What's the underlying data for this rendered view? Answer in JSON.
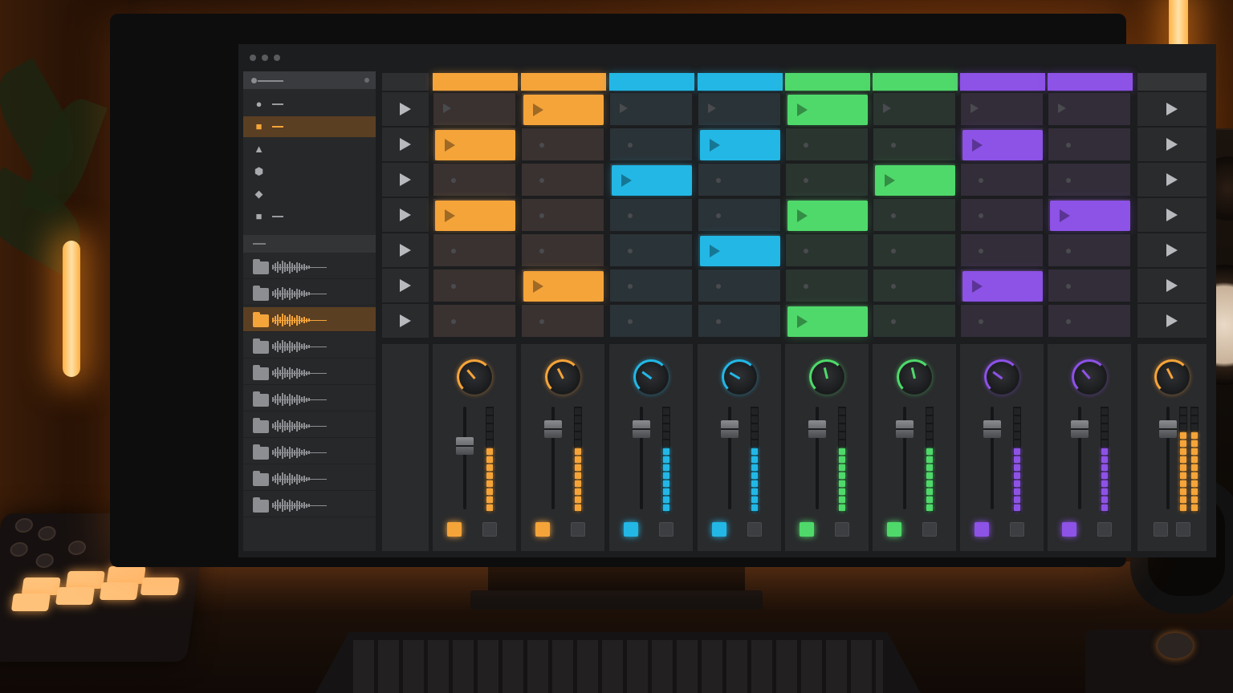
{
  "app": {
    "window_buttons": [
      "close",
      "minimize",
      "maximize"
    ]
  },
  "browser": {
    "header_icon": "search-icon",
    "categories": [
      {
        "icon": "circle-icon",
        "active": false
      },
      {
        "icon": "folder-icon",
        "active": true
      },
      {
        "icon": "triangle-icon",
        "active": false
      },
      {
        "icon": "hexagon-icon",
        "active": false
      },
      {
        "icon": "diamond-icon",
        "active": false
      },
      {
        "icon": "square-icon",
        "active": false
      }
    ],
    "files": [
      {
        "active": false
      },
      {
        "active": false
      },
      {
        "active": true
      },
      {
        "active": false
      },
      {
        "active": false
      },
      {
        "active": false
      },
      {
        "active": false
      },
      {
        "active": false
      },
      {
        "active": false
      },
      {
        "active": false
      }
    ]
  },
  "colors": {
    "orange": "#f5a43a",
    "cyan": "#23b7e5",
    "green": "#4fd96a",
    "purple": "#8d52e6",
    "master": "#f5a43a",
    "selected_outline": "#ffe08a"
  },
  "tracks": [
    {
      "color": "orange",
      "clips": [
        false,
        true,
        false,
        true,
        false,
        false,
        false
      ],
      "selected_clip": 1,
      "knob_value": 0.35,
      "fader_value": 0.62,
      "meter_level": 0.62
    },
    {
      "color": "orange",
      "clips": [
        true,
        false,
        false,
        false,
        false,
        true,
        false
      ],
      "knob_value": 0.4,
      "fader_value": 0.78,
      "meter_level": 0.62
    },
    {
      "color": "cyan",
      "clips": [
        false,
        false,
        true,
        false,
        false,
        false,
        false
      ],
      "knob_value": 0.3,
      "fader_value": 0.78,
      "meter_level": 0.65
    },
    {
      "color": "cyan",
      "clips": [
        false,
        true,
        false,
        false,
        true,
        false,
        false
      ],
      "knob_value": 0.28,
      "fader_value": 0.78,
      "meter_level": 0.65
    },
    {
      "color": "green",
      "clips": [
        true,
        false,
        false,
        true,
        false,
        false,
        true
      ],
      "knob_value": 0.45,
      "fader_value": 0.78,
      "meter_level": 0.65
    },
    {
      "color": "green",
      "clips": [
        false,
        false,
        true,
        false,
        false,
        false,
        false
      ],
      "knob_value": 0.45,
      "fader_value": 0.78,
      "meter_level": 0.65
    },
    {
      "color": "purple",
      "clips": [
        false,
        true,
        false,
        false,
        false,
        true,
        false
      ],
      "knob_value": 0.3,
      "fader_value": 0.78,
      "meter_level": 0.65
    },
    {
      "color": "purple",
      "clips": [
        false,
        false,
        false,
        true,
        false,
        false,
        false
      ],
      "knob_value": 0.35,
      "fader_value": 0.78,
      "meter_level": 0.65
    }
  ],
  "master": {
    "knob_value": 0.4,
    "fader_value": 0.78,
    "meter_level": 0.8
  },
  "scene_count": 7
}
